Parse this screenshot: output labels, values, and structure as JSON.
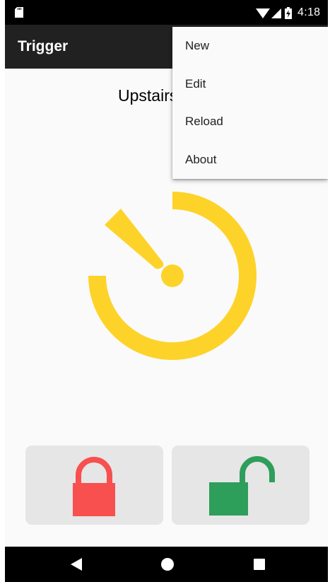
{
  "status_bar": {
    "time": "4:18",
    "icons": [
      "sd-card-icon",
      "wifi-icon",
      "signal-icon",
      "battery-charging-icon"
    ]
  },
  "app_bar": {
    "title": "Trigger"
  },
  "main": {
    "trigger_name": "Upstairs",
    "timer_icon": "timer-icon",
    "timer_color": "#fdd32a"
  },
  "lock_buttons": [
    {
      "name": "lock",
      "icon": "locked-padlock-icon",
      "color": "#f84f4f"
    },
    {
      "name": "unlock",
      "icon": "unlocked-padlock-icon",
      "color": "#2e9e5b"
    }
  ],
  "menu": {
    "items": [
      {
        "label": "New"
      },
      {
        "label": "Edit"
      },
      {
        "label": "Reload"
      },
      {
        "label": "About"
      }
    ]
  },
  "nav_bar": {
    "icons": [
      "back-icon",
      "home-icon",
      "recents-icon"
    ]
  }
}
